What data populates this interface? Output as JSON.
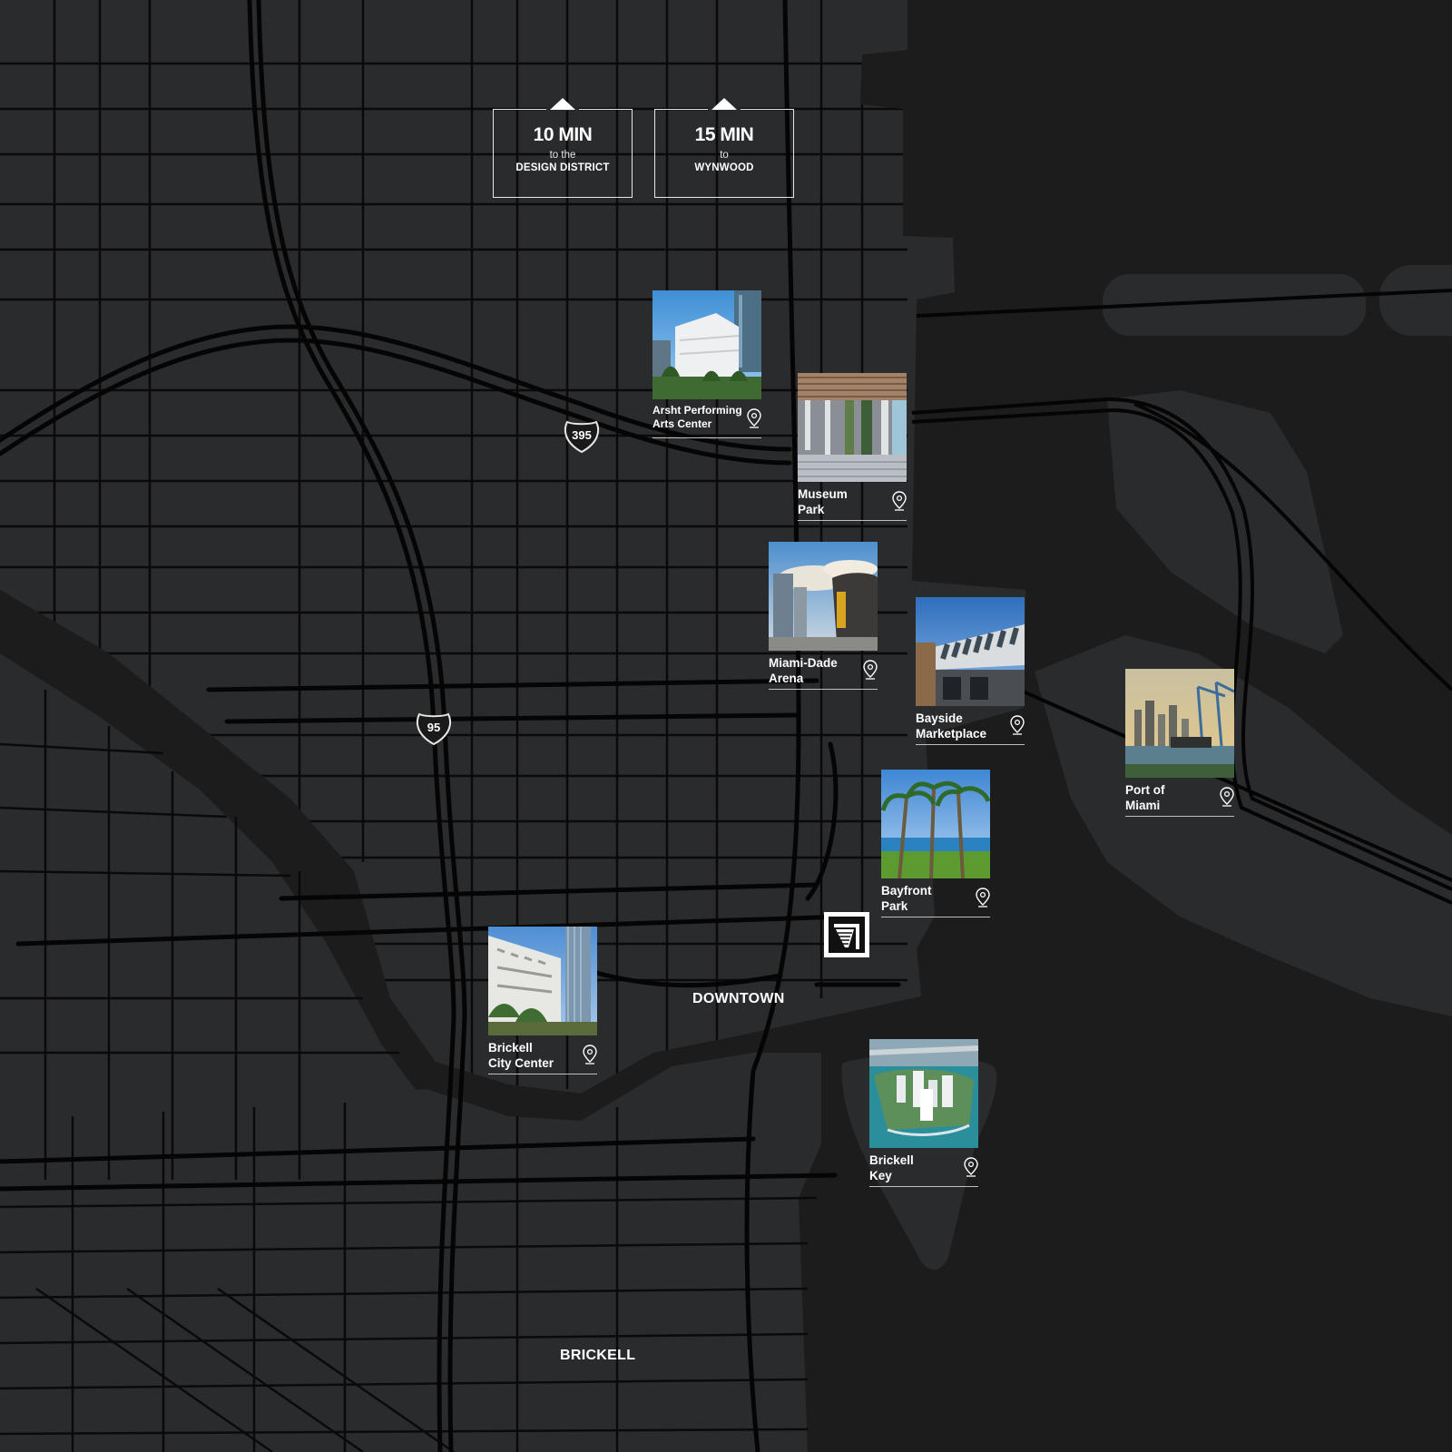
{
  "travel_times": [
    {
      "mins": "10 MIN",
      "connector": "to the",
      "destination": "DESIGN DISTRICT"
    },
    {
      "mins": "15 MIN",
      "connector": "to",
      "destination": "WYNWOOD"
    }
  ],
  "highways": [
    {
      "number": "395"
    },
    {
      "number": "95"
    }
  ],
  "districts": {
    "downtown": "DOWNTOWN",
    "brickell": "BRICKELL"
  },
  "places": [
    {
      "line1": "Arsht Performing",
      "line2": "Arts Center",
      "icon": "location-pin-icon"
    },
    {
      "line1": "Museum",
      "line2": "Park",
      "icon": "location-pin-icon"
    },
    {
      "line1": "Miami-Dade",
      "line2": "Arena",
      "icon": "location-pin-icon"
    },
    {
      "line1": "Bayside",
      "line2": "Marketplace",
      "icon": "location-pin-icon"
    },
    {
      "line1": "Port of",
      "line2": "Miami",
      "icon": "location-pin-icon"
    },
    {
      "line1": "Bayfront",
      "line2": "Park",
      "icon": "location-pin-icon"
    },
    {
      "line1": "Brickell",
      "line2": "City Center",
      "icon": "location-pin-icon"
    },
    {
      "line1": "Brickell",
      "line2": "Key",
      "icon": "location-pin-icon"
    }
  ],
  "colors": {
    "land": "#2a2b2d",
    "water": "#1c1c1d",
    "road": "#0b0b0c",
    "text": "#ffffff"
  }
}
